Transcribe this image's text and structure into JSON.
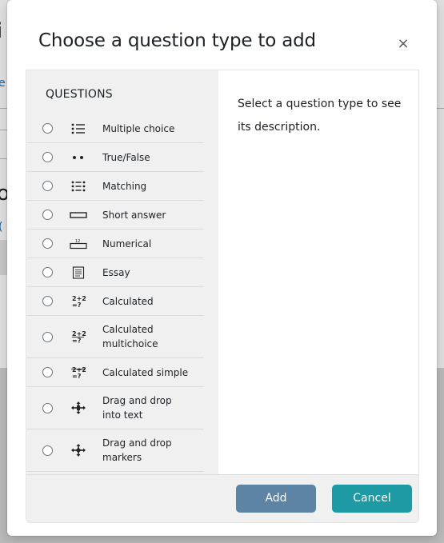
{
  "background": {
    "fragments": [
      "i",
      "e",
      "o",
      "("
    ]
  },
  "modal": {
    "title": "Choose a question type to add",
    "close_symbol": "×",
    "section_label": "QUESTIONS",
    "description": "Select a question type to see its description.",
    "questions": [
      {
        "label": "Multiple choice",
        "icon": "list-bullet-icon"
      },
      {
        "label": "True/False",
        "icon": "two-dots-icon"
      },
      {
        "label": "Matching",
        "icon": "matching-list-icon"
      },
      {
        "label": "Short answer",
        "icon": "text-box-icon"
      },
      {
        "label": "Numerical",
        "icon": "numeric-box-icon"
      },
      {
        "label": "Essay",
        "icon": "essay-icon"
      },
      {
        "label": "Calculated",
        "icon": "calculated-icon"
      },
      {
        "label": "Calculated multichoice",
        "icon": "calculated-multichoice-icon"
      },
      {
        "label": "Calculated simple",
        "icon": "calculated-simple-icon"
      },
      {
        "label": "Drag and drop into text",
        "icon": "drag-drop-text-icon"
      },
      {
        "label": "Drag and drop markers",
        "icon": "drag-drop-markers-icon"
      }
    ],
    "buttons": {
      "add": "Add",
      "cancel": "Cancel"
    },
    "colors": {
      "add_button": "#5d84a4",
      "cancel_button": "#1d9aa3",
      "pane_background": "#f0f0f0"
    }
  }
}
